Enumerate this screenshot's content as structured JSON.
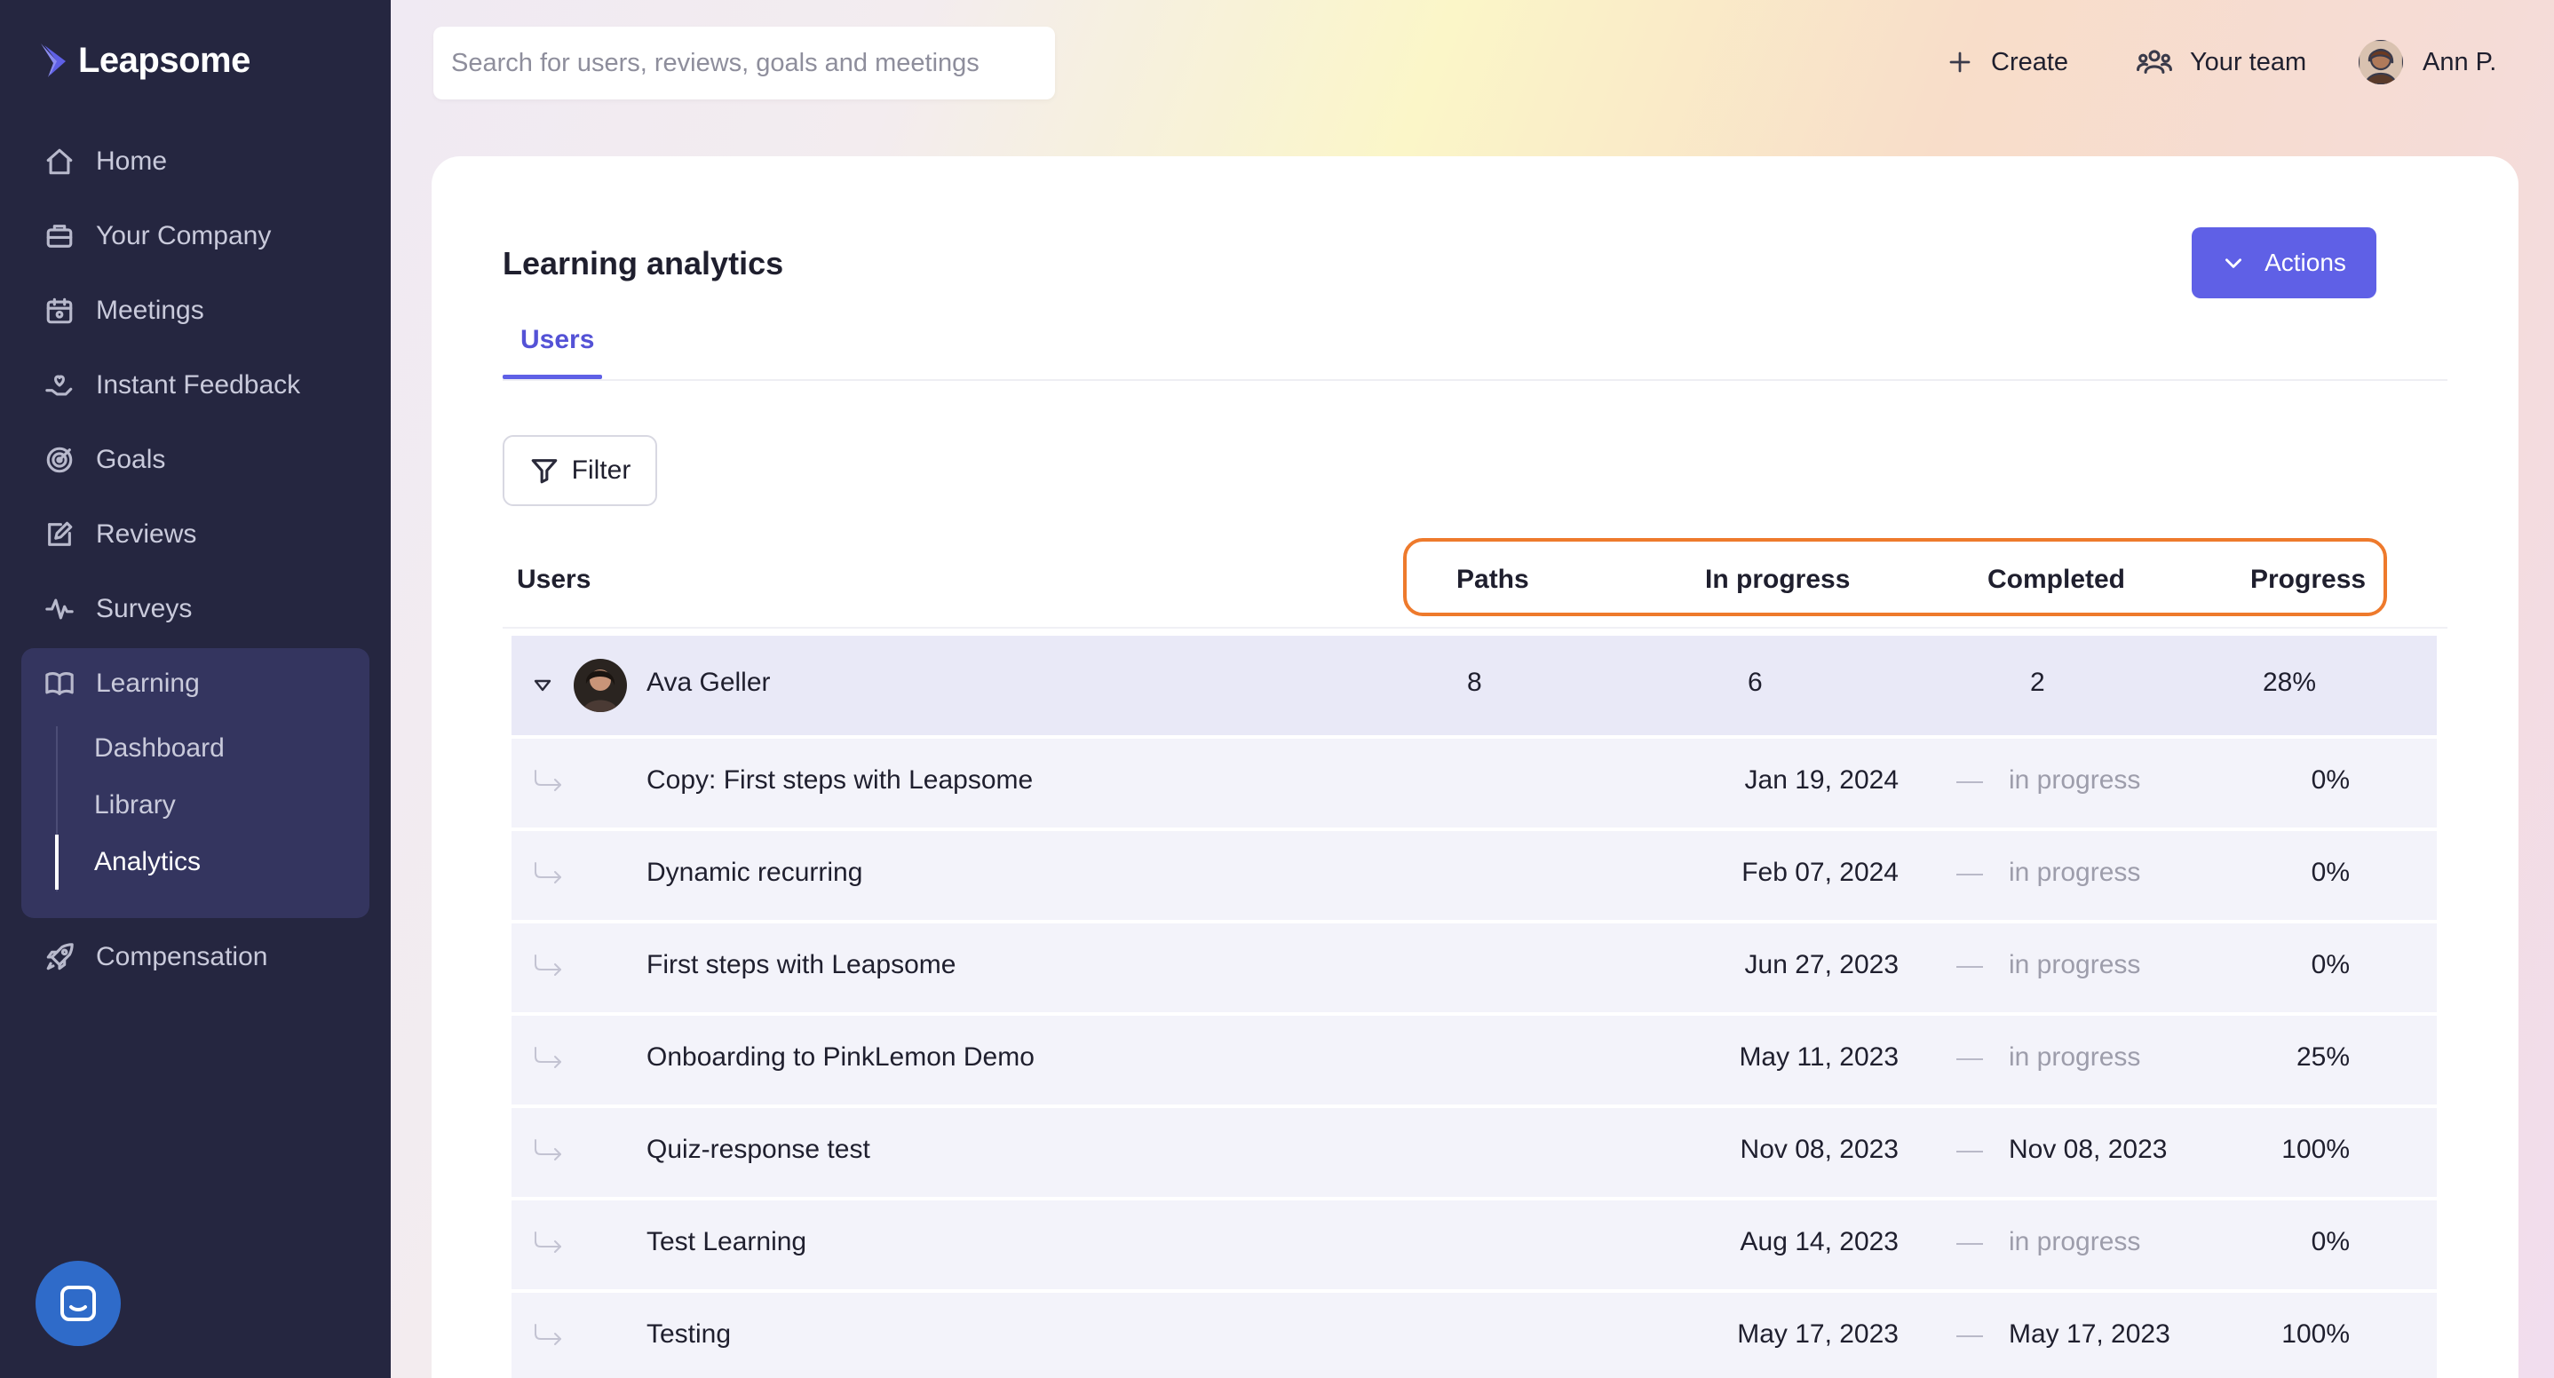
{
  "brand": {
    "name": "Leapsome"
  },
  "sidebar": {
    "items": [
      {
        "label": "Home",
        "icon": "home-icon"
      },
      {
        "label": "Your Company",
        "icon": "briefcase-icon"
      },
      {
        "label": "Meetings",
        "icon": "calendar-icon"
      },
      {
        "label": "Instant Feedback",
        "icon": "hand-heart-icon"
      },
      {
        "label": "Goals",
        "icon": "target-icon"
      },
      {
        "label": "Reviews",
        "icon": "edit-icon"
      },
      {
        "label": "Surveys",
        "icon": "pulse-icon"
      },
      {
        "label": "Learning",
        "icon": "book-icon"
      },
      {
        "label": "Compensation",
        "icon": "rocket-icon"
      }
    ],
    "learning_sub": [
      {
        "label": "Dashboard"
      },
      {
        "label": "Library"
      },
      {
        "label": "Analytics"
      }
    ]
  },
  "topbar": {
    "search_placeholder": "Search for users, reviews, goals and meetings",
    "create_label": "Create",
    "team_label": "Your team",
    "user_label": "Ann P."
  },
  "page": {
    "title": "Learning analytics",
    "actions_label": "Actions",
    "tab_users": "Users",
    "filter_label": "Filter"
  },
  "table": {
    "headers": {
      "users": "Users",
      "paths": "Paths",
      "in_progress": "In progress",
      "completed": "Completed",
      "progress": "Progress"
    },
    "user": {
      "name": "Ava Geller",
      "paths": "8",
      "in_progress": "6",
      "completed": "2",
      "progress": "28%"
    },
    "rows": [
      {
        "title": "Copy: First steps with Leapsome",
        "start": "Jan 19, 2024",
        "end": "in progress",
        "progress": "0%"
      },
      {
        "title": "Dynamic recurring",
        "start": "Feb 07, 2024",
        "end": "in progress",
        "progress": "0%"
      },
      {
        "title": "First steps with Leapsome",
        "start": "Jun 27, 2023",
        "end": "in progress",
        "progress": "0%"
      },
      {
        "title": "Onboarding to PinkLemon Demo",
        "start": "May 11, 2023",
        "end": "in progress",
        "progress": "25%"
      },
      {
        "title": "Quiz-response test",
        "start": "Nov 08, 2023",
        "end": "Nov 08, 2023",
        "progress": "100%"
      },
      {
        "title": "Test Learning",
        "start": "Aug 14, 2023",
        "end": "in progress",
        "progress": "0%"
      },
      {
        "title": "Testing",
        "start": "May 17, 2023",
        "end": "May 17, 2023",
        "progress": "100%"
      }
    ]
  },
  "colors": {
    "sidebar_bg": "#252640",
    "accent": "#5f60e6",
    "highlight": "#ee7a2c"
  }
}
